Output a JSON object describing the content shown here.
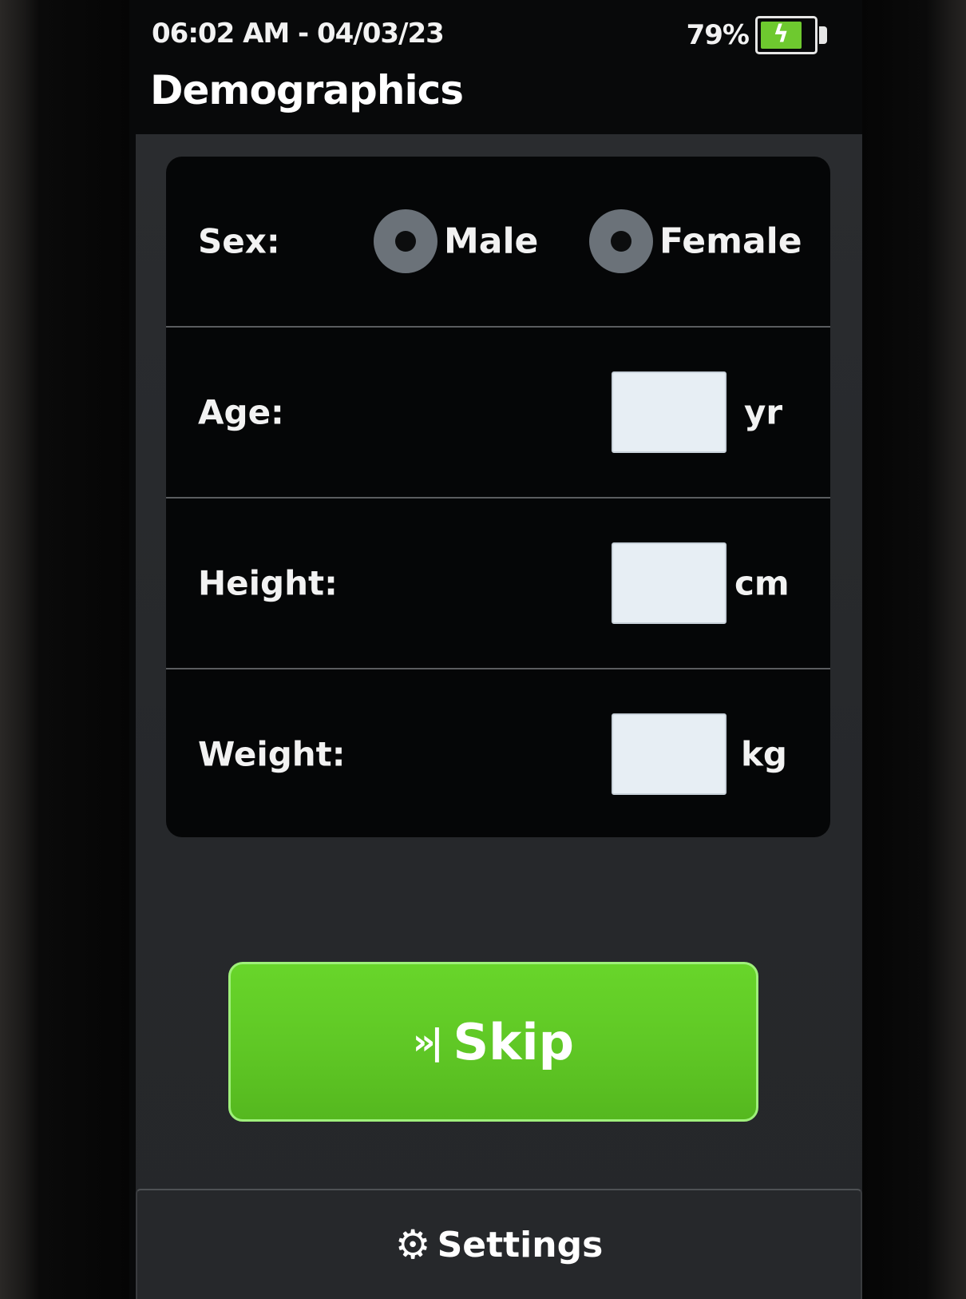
{
  "status_bar": {
    "datetime": "06:02 AM - 04/03/23",
    "battery_percent": "79%",
    "battery_level": 0.79,
    "battery_color": "#6ec92f"
  },
  "header": {
    "title": "Demographics"
  },
  "form": {
    "sex": {
      "label": "Sex:",
      "options": [
        {
          "label": "Male",
          "selected": false
        },
        {
          "label": "Female",
          "selected": false
        }
      ]
    },
    "age": {
      "label": "Age:",
      "value": "",
      "unit": "yr"
    },
    "height": {
      "label": "Height:",
      "value": "",
      "unit": "cm"
    },
    "weight": {
      "label": "Weight:",
      "value": "",
      "unit": "kg"
    }
  },
  "actions": {
    "skip_icon": "»|",
    "skip_label": "Skip",
    "skip_color": "#5fc725"
  },
  "footer": {
    "settings_icon": "gear-icon",
    "settings_label": "Settings"
  }
}
